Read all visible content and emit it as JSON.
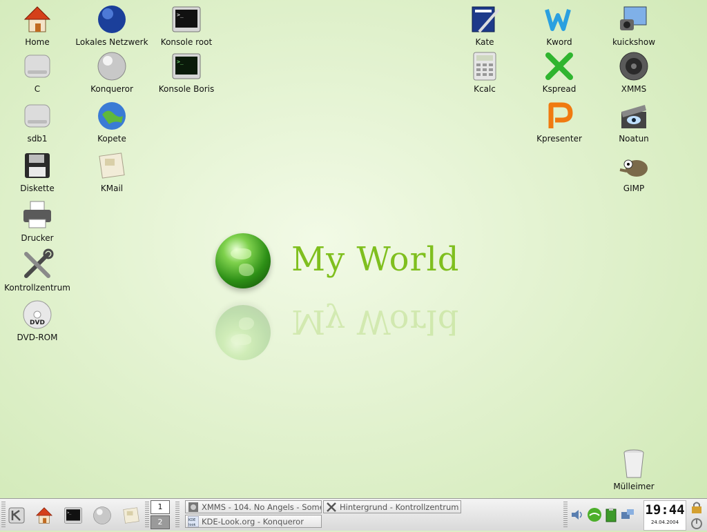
{
  "desktop": {
    "icons": [
      {
        "label": "Home",
        "icon": "home-icon"
      },
      {
        "label": "C",
        "icon": "hard-drive-icon"
      },
      {
        "label": "sdb1",
        "icon": "hard-drive-icon"
      },
      {
        "label": "Diskette",
        "icon": "floppy-icon"
      },
      {
        "label": "Drucker",
        "icon": "printer-icon"
      },
      {
        "label": "Kontrollzentrum",
        "icon": "tools-icon"
      },
      {
        "label": "DVD-ROM",
        "icon": "dvd-icon"
      },
      {
        "label": "Lokales Netzwerk",
        "icon": "network-globe-icon"
      },
      {
        "label": "Konqueror",
        "icon": "konqueror-icon"
      },
      {
        "label": "Kopete",
        "icon": "kopete-icon"
      },
      {
        "label": "KMail",
        "icon": "kmail-icon"
      },
      {
        "label": "Konsole root",
        "icon": "terminal-icon"
      },
      {
        "label": "Konsole Boris",
        "icon": "terminal-icon"
      },
      {
        "label": "Kate",
        "icon": "kate-icon"
      },
      {
        "label": "Kcalc",
        "icon": "calculator-icon"
      },
      {
        "label": "Kword",
        "icon": "kword-icon"
      },
      {
        "label": "Kspread",
        "icon": "kspread-icon"
      },
      {
        "label": "Kpresenter",
        "icon": "kpresenter-icon"
      },
      {
        "label": "kuickshow",
        "icon": "kuickshow-icon"
      },
      {
        "label": "XMMS",
        "icon": "speaker-icon"
      },
      {
        "label": "Noatun",
        "icon": "noatun-icon"
      },
      {
        "label": "GIMP",
        "icon": "gimp-icon"
      },
      {
        "label": "Mülleimer",
        "icon": "trash-icon"
      }
    ],
    "wallpaper_text": "My World"
  },
  "taskbar": {
    "pager": [
      "1",
      "2"
    ],
    "tasks": [
      {
        "label": "XMMS - 104. No Angels - Some",
        "icon": "xmms-task-icon"
      },
      {
        "label": "Hintergrund - Kontrollzentrum",
        "icon": "tools-task-icon"
      },
      {
        "label": "KDE-Look.org - Konqueror",
        "icon": "kde-task-icon"
      }
    ],
    "clock": {
      "time": "19:44",
      "date": "24.04.2004"
    }
  },
  "colors": {
    "wallpaper": "#dff0cb",
    "logo_text": "#7fbf1e"
  }
}
